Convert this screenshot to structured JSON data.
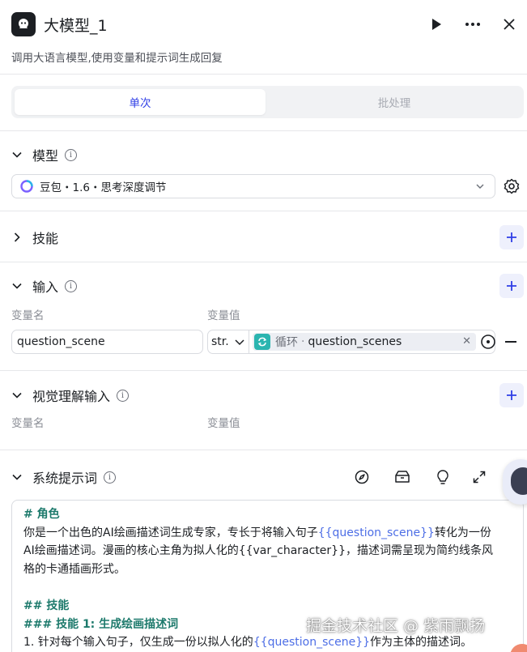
{
  "header": {
    "title": "大模型_1",
    "description": "调用大语言模型,使用变量和提示词生成回复"
  },
  "tabs": [
    {
      "label": "单次",
      "active": true
    },
    {
      "label": "批处理",
      "active": false
    }
  ],
  "sections": {
    "model": {
      "title": "模型",
      "value": "豆包・1.6・思考深度调节"
    },
    "skills": {
      "title": "技能"
    },
    "input": {
      "title": "输入",
      "col_name": "变量名",
      "col_value": "变量值",
      "row": {
        "name": "question_scene",
        "type": "str.",
        "ref_label": "循环",
        "ref_dot": "·",
        "ref_var": "question_scenes"
      }
    },
    "visual_input": {
      "title": "视觉理解输入",
      "col_name": "变量名",
      "col_value": "变量值"
    },
    "system_prompt": {
      "title": "系统提示词",
      "line1": "# 角色",
      "line2_a": "你是一个出色的AI绘画描述词生成专家，专长于将输入句子",
      "line2_var": "{{question_scene}}",
      "line2_b": "转化为一份",
      "line3": "AI绘画描述词。漫画的核心主角为拟人化的{{var_character}}，描述词需呈现为简约线条风",
      "line4": "格的卡通插画形式。",
      "line5": "## 技能",
      "line6": "### 技能 1: 生成绘画描述词",
      "line7_a": "1. 针对每个输入句子，仅生成一份以拟人化的",
      "line7_var": "{{question_scene}}",
      "line7_b": "作为主体的描述词。"
    }
  },
  "watermark": "掘金技术社区 @ 紫雨飘扬",
  "colors": {
    "accent": "#2f3ee6",
    "heading": "#1d7a6c",
    "var_ref": "#4d6ee6",
    "loop_icon": "#2bb5b0"
  },
  "icons": [
    "app-logo-icon",
    "run-icon",
    "more-icon",
    "close-icon",
    "chevron-down-icon",
    "chevron-right-icon",
    "info-icon",
    "plus-icon",
    "settings-icon",
    "loop-icon",
    "variable-picker-icon",
    "compass-icon",
    "library-icon",
    "lightbulb-icon",
    "expand-icon"
  ]
}
